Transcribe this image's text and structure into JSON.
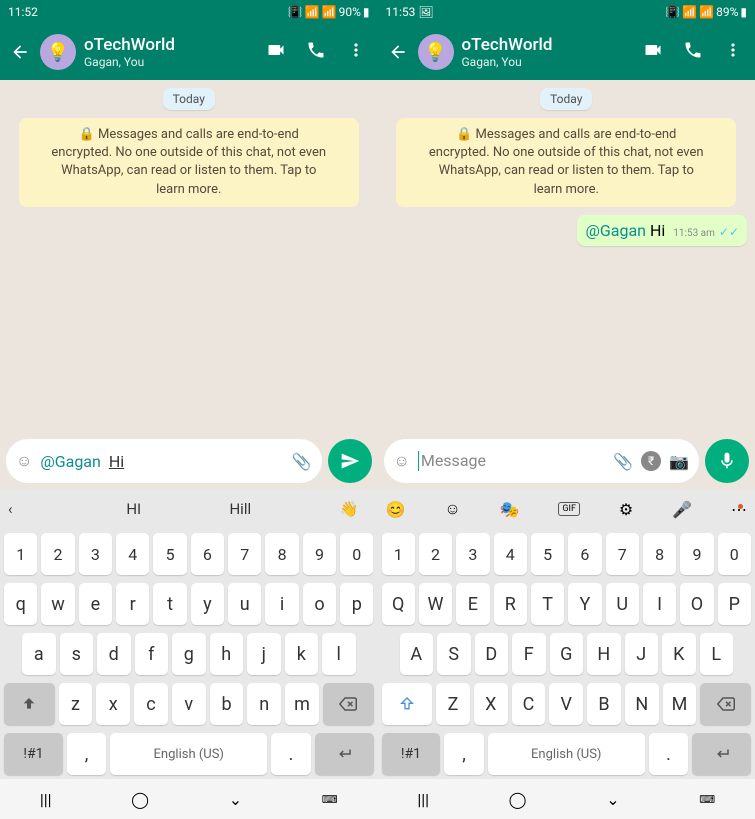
{
  "left": {
    "status": {
      "time": "11:52",
      "battery": "90%"
    },
    "header": {
      "name": "oTechWorld",
      "sub": "Gagan, You"
    },
    "today": "Today",
    "encryption": "🔒 Messages and calls are end-to-end encrypted. No one outside of this chat, not even WhatsApp, can read or listen to them. Tap to learn more.",
    "input": {
      "mention": "@Gagan",
      "text": "Hi"
    },
    "keyboard": {
      "suggestions": {
        "back": "‹",
        "s1": "HI",
        "s2": "Hill",
        "emoji": "👋"
      },
      "row1": [
        "1",
        "2",
        "3",
        "4",
        "5",
        "6",
        "7",
        "8",
        "9",
        "0"
      ],
      "row2": [
        "q",
        "w",
        "e",
        "r",
        "t",
        "y",
        "u",
        "i",
        "o",
        "p"
      ],
      "row3": [
        "a",
        "s",
        "d",
        "f",
        "g",
        "h",
        "j",
        "k",
        "l"
      ],
      "row4": [
        "z",
        "x",
        "c",
        "v",
        "b",
        "n",
        "m"
      ],
      "sym": "!#1",
      "comma": ",",
      "space": "English (US)",
      "period": "."
    }
  },
  "right": {
    "status": {
      "time": "11:53",
      "battery": "89%"
    },
    "header": {
      "name": "oTechWorld",
      "sub": "Gagan, You"
    },
    "today": "Today",
    "encryption": "🔒 Messages and calls are end-to-end encrypted. No one outside of this chat, not even WhatsApp, can read or listen to them. Tap to learn more.",
    "message": {
      "mention": "@Gagan",
      "text": "Hi",
      "time": "11:53 am"
    },
    "input": {
      "placeholder": "Message"
    },
    "keyboard": {
      "row1": [
        "1",
        "2",
        "3",
        "4",
        "5",
        "6",
        "7",
        "8",
        "9",
        "0"
      ],
      "row2": [
        "Q",
        "W",
        "E",
        "R",
        "T",
        "Y",
        "U",
        "I",
        "O",
        "P"
      ],
      "row3": [
        "A",
        "S",
        "D",
        "F",
        "G",
        "H",
        "J",
        "K",
        "L"
      ],
      "row4": [
        "Z",
        "X",
        "C",
        "V",
        "B",
        "N",
        "M"
      ],
      "sym": "!#1",
      "comma": ",",
      "space": "English (US)",
      "period": "."
    }
  }
}
